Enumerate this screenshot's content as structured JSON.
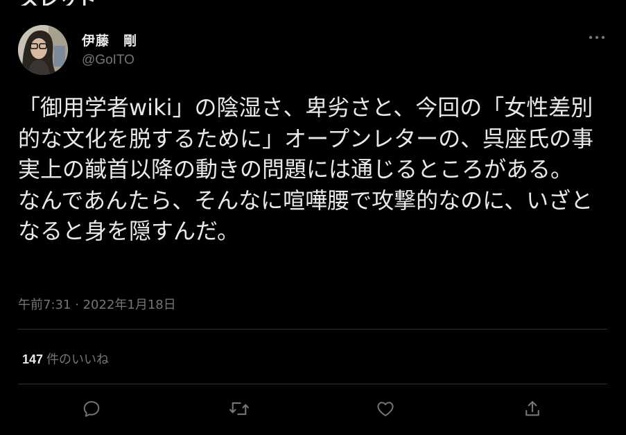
{
  "header": {
    "title": "スレッド"
  },
  "author": {
    "display_name": "伊藤　剛",
    "handle": "@GoITO"
  },
  "tweet": {
    "text": "「御用学者wiki」の陰湿さ、卑劣さと、今回の「女性差別的な文化を脱するために」オープンレターの、呉座氏の事実上の馘首以降の動きの問題には通じるところがある。\nなんであんたら、そんなに喧嘩腰で攻撃的なのに、いざとなると身を隠すんだ。",
    "timestamp": "午前7:31 · 2022年1月18日"
  },
  "stats": {
    "likes_count": "147",
    "likes_label": "件のいいね"
  },
  "actions": [
    {
      "name": "reply",
      "icon": "reply-icon"
    },
    {
      "name": "retweet",
      "icon": "retweet-icon"
    },
    {
      "name": "like",
      "icon": "heart-icon"
    },
    {
      "name": "share",
      "icon": "share-icon"
    }
  ],
  "colors": {
    "background": "#000000",
    "primary_text": "#e7e9ea",
    "secondary_text": "#71767b",
    "divider": "#2f3336"
  }
}
